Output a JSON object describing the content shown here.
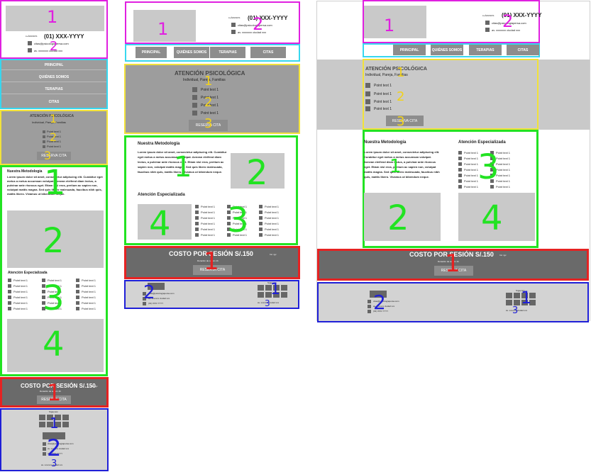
{
  "header": {
    "phone": "(01) XXX-YYYY",
    "phone_label": "LLÁMANOS",
    "email": "citas@psicologiapersa.com",
    "address": "av. xxxxxxx ciudad xxx"
  },
  "nav": {
    "items": [
      "PRINCIPAL",
      "QUIÉNES SOMOS",
      "TERAPIAS",
      "CITAS"
    ]
  },
  "hero": {
    "title": "ATENCIÓN PSICOLÓGICA",
    "subtitle": "Individual, Pareja, Familias",
    "points": [
      "Point text 1",
      "Point text 1",
      "Point text 1",
      "Point text 1"
    ],
    "button": "RESERVA CITA"
  },
  "content": {
    "metodologia_title": "Nuestra Metodología",
    "metodologia_text": "Lorem ipsum dolor sit amet, consectetur adipiscing elit. Curabitur eget metus a metus accumsan volutpat. Aenean eleifend diam lectus, a pulvinar ante rhoncus eget. Etiam nisl eros, pretium ac sapien non, volutpat mattis magna. Sed quis libero malesuada, faucibus nibh quis, mattis libero. Vivamus ut bibendum neque.",
    "especializada_title": "Atención Especializada",
    "point": "Point text 1"
  },
  "cost": {
    "title": "COSTO POR SESIÓN S/.150",
    "note": "Inc. igv",
    "subtitle": "Duración de sesión 1h",
    "button": "RESERVA CITA"
  },
  "footer": {
    "line1": "citas@psicologiapersa.com",
    "line2": "av. xxxxxxx ciudad xxx",
    "line3": "(01) XXX-YYYY",
    "social": "Síguenos"
  },
  "labels": {
    "one": "1",
    "two": "2",
    "three": "3",
    "four": "4"
  }
}
